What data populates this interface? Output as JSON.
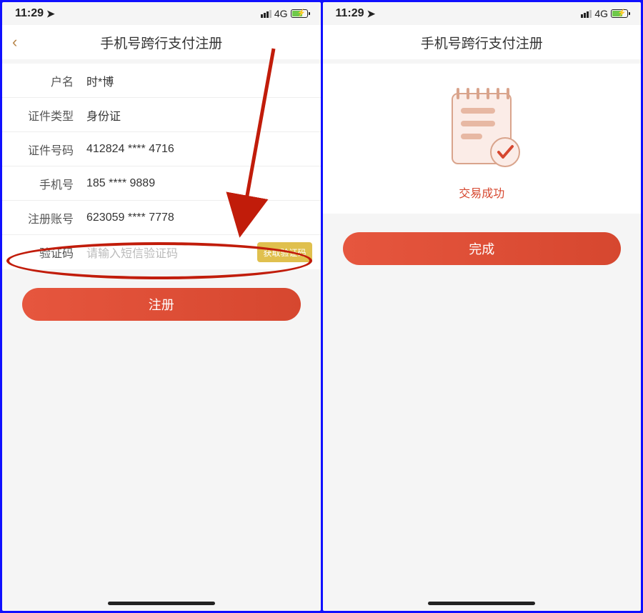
{
  "status": {
    "time": "11:29",
    "net": "4G"
  },
  "nav": {
    "title": "手机号跨行支付注册"
  },
  "form": {
    "rows": [
      {
        "label": "户名",
        "value": "时*博"
      },
      {
        "label": "证件类型",
        "value": "身份证"
      },
      {
        "label": "证件号码",
        "value": "412824 **** 4716"
      },
      {
        "label": "手机号",
        "value": "185 **** 9889"
      },
      {
        "label": "注册账号",
        "value": "623059 **** 7778"
      }
    ],
    "code_label": "验证码",
    "code_placeholder": "请输入短信验证码",
    "get_code": "获取验证码",
    "submit": "注册"
  },
  "success": {
    "text": "交易成功",
    "button": "完成"
  }
}
